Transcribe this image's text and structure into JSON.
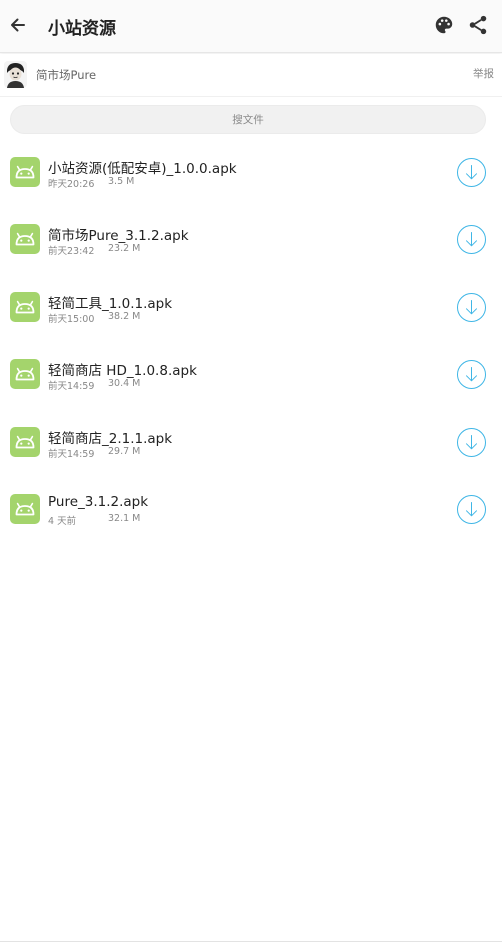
{
  "header": {
    "title": "小站资源"
  },
  "owner": {
    "name": "简市场Pure",
    "report_label": "举报"
  },
  "search": {
    "placeholder": "搜文件"
  },
  "colors": {
    "android_green": "#a4d46c",
    "download_blue": "#3fb6e6"
  },
  "files": [
    {
      "name": "小站资源(低配安卓)_1.0.0.apk",
      "time": "昨天20:26",
      "size": "3.5 M",
      "icon": "android-icon"
    },
    {
      "name": "简市场Pure_3.1.2.apk",
      "time": "前天23:42",
      "size": "23.2 M",
      "icon": "android-icon"
    },
    {
      "name": "轻简工具_1.0.1.apk",
      "time": "前天15:00",
      "size": "38.2 M",
      "icon": "android-icon"
    },
    {
      "name": "轻简商店 HD_1.0.8.apk",
      "time": "前天14:59",
      "size": "30.4 M",
      "icon": "android-icon"
    },
    {
      "name": "轻简商店_2.1.1.apk",
      "time": "前天14:59",
      "size": "29.7 M",
      "icon": "android-icon"
    },
    {
      "name": "Pure_3.1.2.apk",
      "time": "4 天前",
      "size": "32.1 M",
      "icon": "android-icon"
    }
  ]
}
